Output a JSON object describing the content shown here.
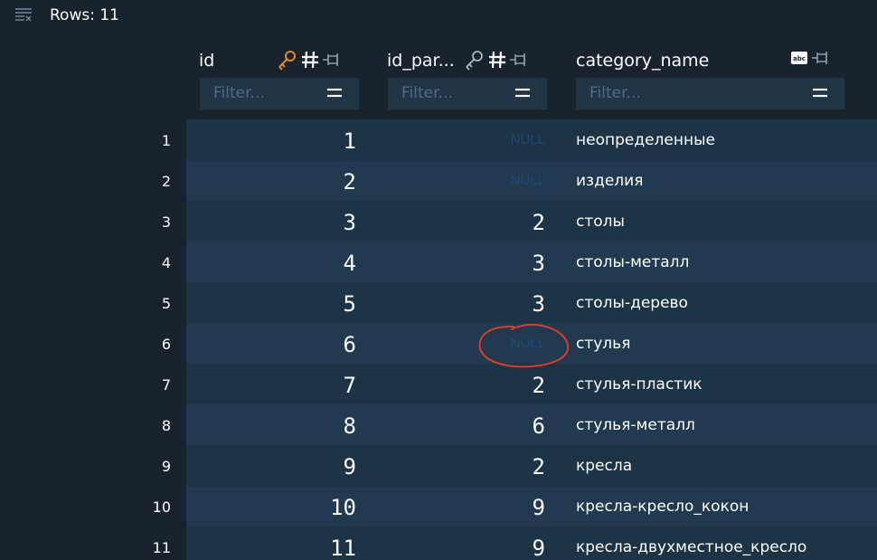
{
  "toolbar": {
    "rows_label": "Rows: 11",
    "rows_icon": "rows-filter-icon"
  },
  "columns": [
    {
      "name": "id",
      "icons": [
        "key-icon",
        "hash-icon",
        "pin-icon"
      ]
    },
    {
      "name": "id_par...",
      "icons": [
        "key-icon",
        "hash-icon",
        "pin-icon"
      ]
    },
    {
      "name": "category_name",
      "icons": [
        "text-type-icon",
        "pin-icon"
      ]
    }
  ],
  "filters": [
    "Filter...",
    "Filter...",
    "Filter..."
  ],
  "rows": [
    {
      "n": "1",
      "id": "1",
      "parent": "NULL",
      "name": "неопределенные"
    },
    {
      "n": "2",
      "id": "2",
      "parent": "NULL",
      "name": "изделия"
    },
    {
      "n": "3",
      "id": "3",
      "parent": "2",
      "name": "столы"
    },
    {
      "n": "4",
      "id": "4",
      "parent": "3",
      "name": "столы-металл"
    },
    {
      "n": "5",
      "id": "5",
      "parent": "3",
      "name": "столы-дерево"
    },
    {
      "n": "6",
      "id": "6",
      "parent": "NULL",
      "name": "стулья"
    },
    {
      "n": "7",
      "id": "7",
      "parent": "2",
      "name": "стулья-пластик"
    },
    {
      "n": "8",
      "id": "8",
      "parent": "6",
      "name": "стулья-металл"
    },
    {
      "n": "9",
      "id": "9",
      "parent": "2",
      "name": "кресла"
    },
    {
      "n": "10",
      "id": "10",
      "parent": "9",
      "name": "кресла-кресло_кокон"
    },
    {
      "n": "11",
      "id": "11",
      "parent": "9",
      "name": "кресла-двухместное_кресло"
    }
  ],
  "colors": {
    "background": "#19232d",
    "row_odd": "#1d3346",
    "row_even": "#213a4f",
    "filter_bg": "#223547",
    "key_primary": "#e08a1e",
    "null_text": "#1e4a78",
    "annotation": "#e03a2a"
  }
}
